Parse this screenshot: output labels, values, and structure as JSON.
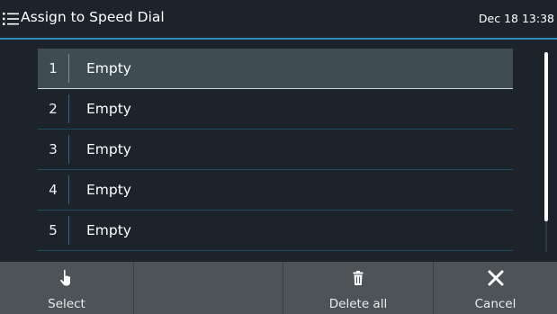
{
  "header": {
    "title": "Assign to Speed Dial",
    "datetime": "Dec 18 13:38",
    "menu_icon": "list-menu-icon"
  },
  "list": {
    "items": [
      {
        "number": "1",
        "label": "Empty",
        "selected": true
      },
      {
        "number": "2",
        "label": "Empty",
        "selected": false
      },
      {
        "number": "3",
        "label": "Empty",
        "selected": false
      },
      {
        "number": "4",
        "label": "Empty",
        "selected": false
      },
      {
        "number": "5",
        "label": "Empty",
        "selected": false
      }
    ]
  },
  "softkeys": {
    "select_label": "Select",
    "select_icon": "hand-pointer-icon",
    "empty_label": "",
    "delete_all_label": "Delete all",
    "delete_all_icon": "trash-icon",
    "cancel_label": "Cancel",
    "cancel_icon": "close-icon"
  },
  "colors": {
    "background": "#1d232b",
    "accent": "#2e8ab8",
    "selected_row": "#3f4d52",
    "softkey_bar": "#4d5357"
  }
}
